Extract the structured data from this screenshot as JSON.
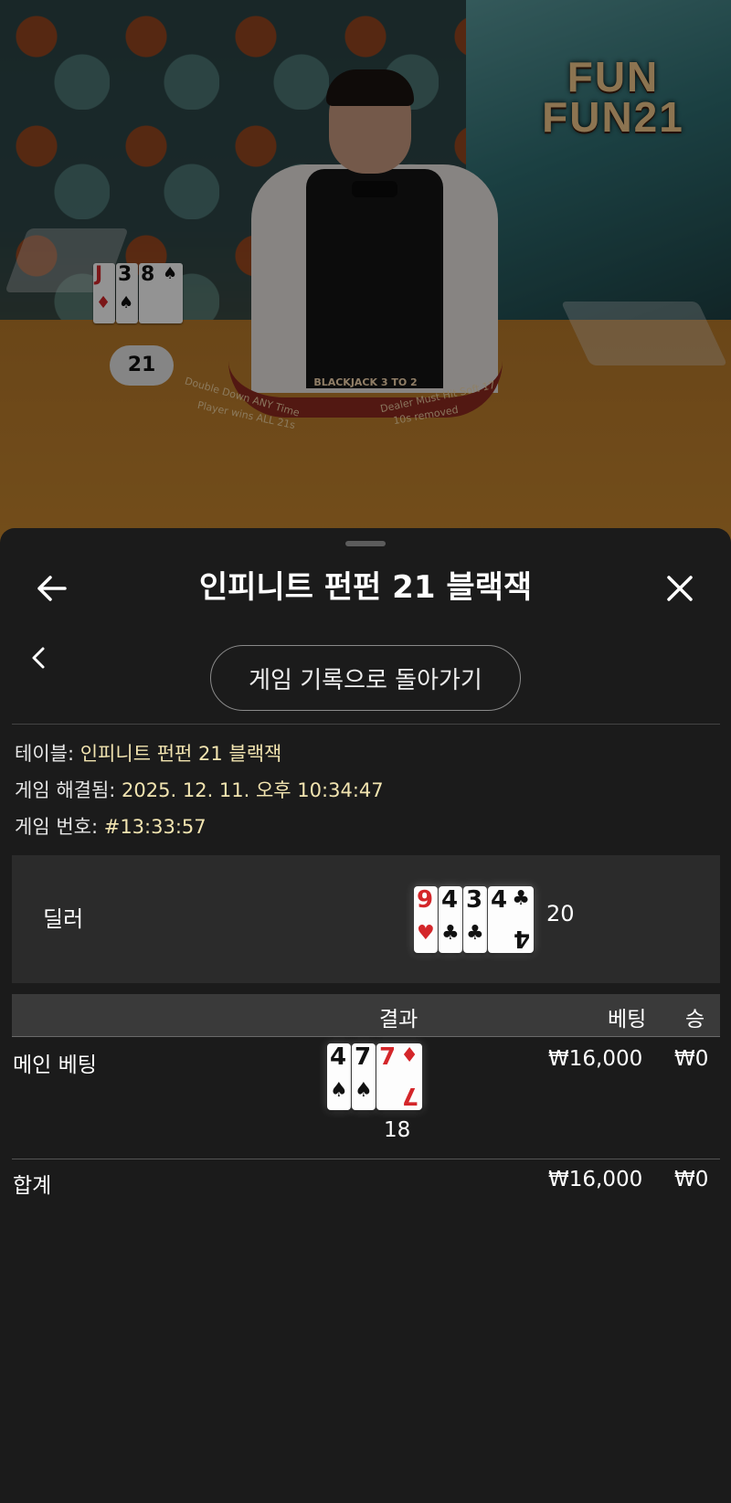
{
  "video": {
    "logo_line1": "FUN",
    "logo_line2": "FUN21",
    "table_arc_text": "BLACKJACK 3 TO 2",
    "felt_left_1": "Double Down ANY Time",
    "felt_left_2": "Player wins ALL 21s",
    "felt_right_1": "Dealer Must Hit Soft 17",
    "felt_right_2": "10s removed",
    "dealer_hand_cards": [
      {
        "rank": "J",
        "suit": "♦",
        "color": "red"
      },
      {
        "rank": "3",
        "suit": "♠",
        "color": "black"
      },
      {
        "rank": "8",
        "suit": "♠",
        "color": "black"
      }
    ],
    "dealer_hand_score": "21"
  },
  "sheet": {
    "title": "인피니트 펀펀 21 블랙잭",
    "back_to_history_label": "게임 기록으로 돌아가기",
    "meta": [
      {
        "key": "테이블:",
        "value": "인피니트 펀펀 21 블랙잭"
      },
      {
        "key": "게임 해결됨:",
        "value": "2025. 12. 11. 오후 10:34:47"
      },
      {
        "key": "게임 번호:",
        "value": "#13:33:57"
      }
    ],
    "dealer": {
      "label": "딜러",
      "cards": [
        {
          "rank": "9",
          "suit": "♥",
          "color": "red"
        },
        {
          "rank": "4",
          "suit": "♣",
          "color": "black"
        },
        {
          "rank": "3",
          "suit": "♣",
          "color": "black"
        },
        {
          "rank": "4",
          "suit": "♣",
          "color": "black"
        }
      ],
      "score": "20"
    },
    "table": {
      "headers": {
        "result": "결과",
        "bet": "베팅",
        "win": "승"
      },
      "main_bet": {
        "label": "메인 베팅",
        "cards": [
          {
            "rank": "4",
            "suit": "♠",
            "color": "black"
          },
          {
            "rank": "7",
            "suit": "♠",
            "color": "black"
          },
          {
            "rank": "7",
            "suit": "♦",
            "color": "red"
          }
        ],
        "score": "18",
        "bet": "₩16,000",
        "win": "₩0"
      },
      "total": {
        "label": "합계",
        "bet": "₩16,000",
        "win": "₩0"
      }
    }
  }
}
